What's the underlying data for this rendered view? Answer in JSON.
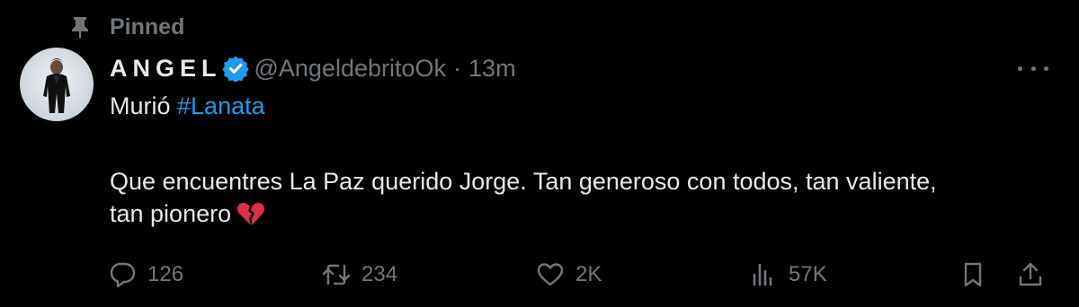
{
  "pinned": {
    "label": "Pinned",
    "icon": "pin-icon"
  },
  "author": {
    "display_name": "ANGEL",
    "handle": "@AngeldebritoOk",
    "separator": "·",
    "time": "13m",
    "verified_color": "#1d9bf0"
  },
  "tweet": {
    "line1_text": "Murió ",
    "hashtag": "#Lanata",
    "line2": "Que encuentres La Paz querido Jorge. Tan generoso con todos, tan valiente,",
    "line3": "tan pionero",
    "emoji": "broken-heart"
  },
  "actions": {
    "replies": "126",
    "retweets": "234",
    "likes": "2K",
    "views": "57K"
  },
  "colors": {
    "background": "#000000",
    "text": "#e7e9ea",
    "muted": "#71767b",
    "link": "#1d9bf0"
  }
}
